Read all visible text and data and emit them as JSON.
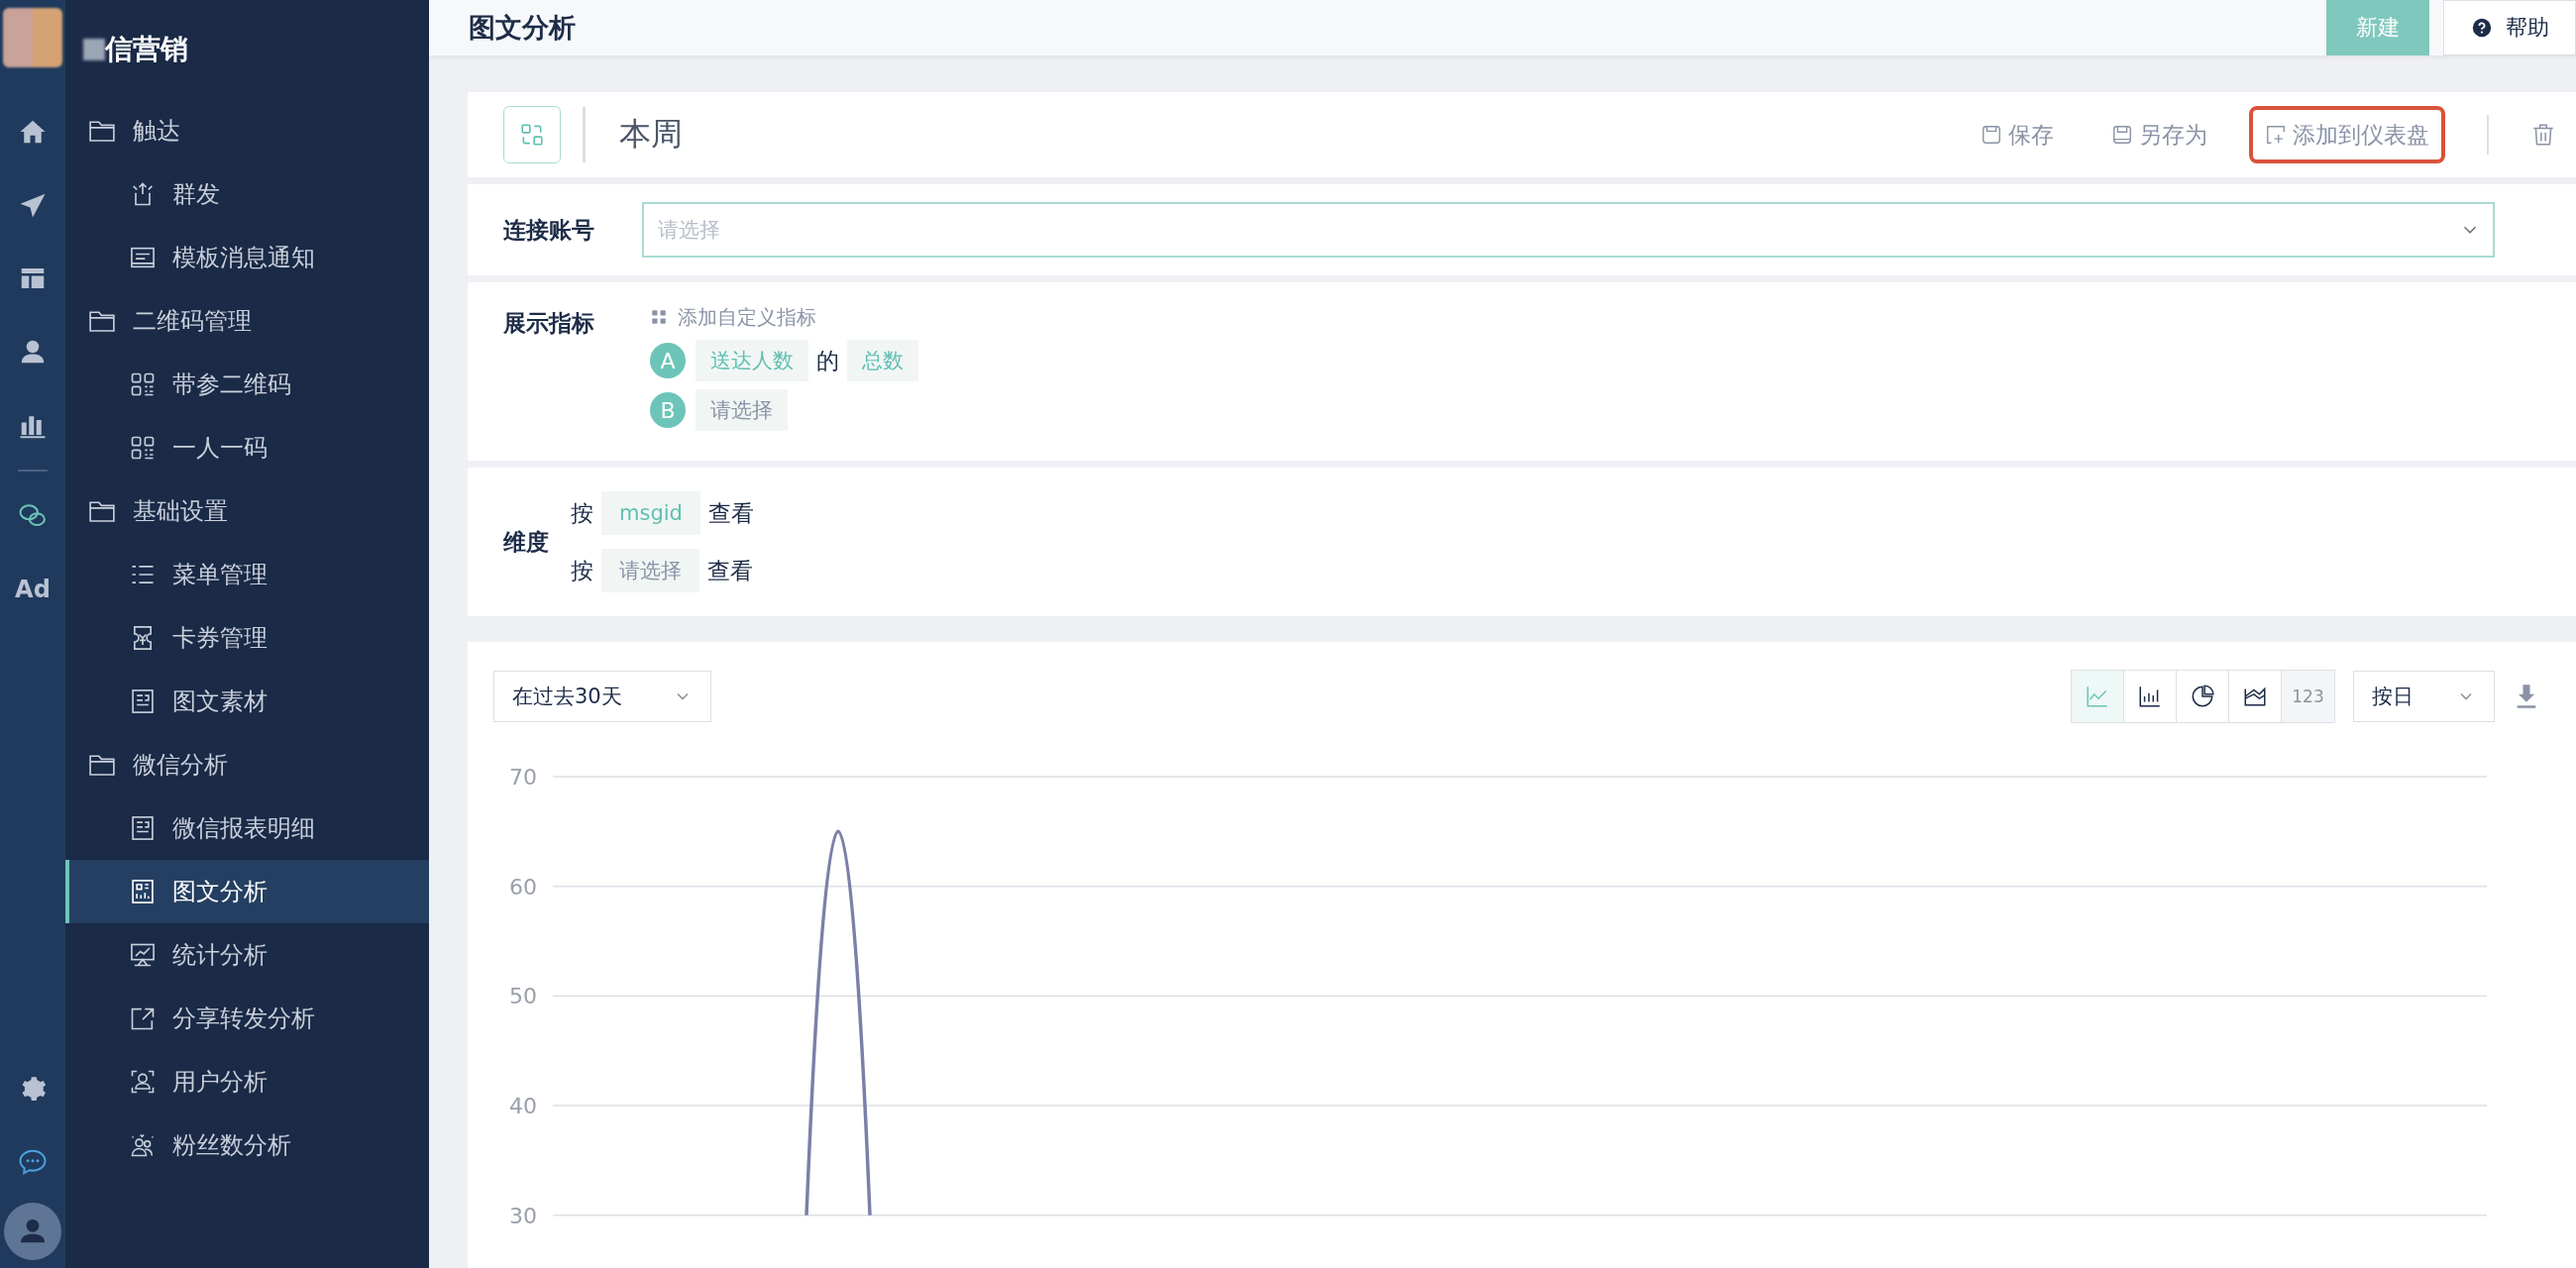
{
  "rail": {
    "top": [
      {
        "kind": "home"
      },
      {
        "kind": "send"
      },
      {
        "kind": "layout"
      },
      {
        "kind": "user"
      },
      {
        "kind": "chart"
      },
      {
        "kind": "divider"
      },
      {
        "kind": "wechat"
      },
      {
        "kind": "ad",
        "label": "Ad"
      }
    ],
    "bottom": [
      {
        "kind": "gear"
      },
      {
        "kind": "chat"
      },
      {
        "kind": "avatar"
      }
    ]
  },
  "sidebar": {
    "title": "信营销",
    "groups": [
      {
        "label": "触达",
        "children": [
          {
            "label": "群发",
            "selected": false
          },
          {
            "label": "模板消息通知",
            "selected": false
          }
        ]
      },
      {
        "label": "二维码管理",
        "children": [
          {
            "label": "带参二维码",
            "selected": false
          },
          {
            "label": "一人一码",
            "selected": false
          }
        ]
      },
      {
        "label": "基础设置",
        "children": [
          {
            "label": "菜单管理",
            "selected": false
          },
          {
            "label": "卡券管理",
            "selected": false
          },
          {
            "label": "图文素材",
            "selected": false
          }
        ]
      },
      {
        "label": "微信分析",
        "children": [
          {
            "label": "微信报表明细",
            "selected": false
          },
          {
            "label": "图文分析",
            "selected": true
          },
          {
            "label": "统计分析",
            "selected": false
          },
          {
            "label": "分享转发分析",
            "selected": false
          },
          {
            "label": "用户分析",
            "selected": false
          },
          {
            "label": "粉丝数分析",
            "selected": false
          }
        ]
      }
    ]
  },
  "header": {
    "title": "图文分析",
    "buttons": [
      {
        "kind": "primary",
        "label": "新建"
      },
      {
        "kind": "help",
        "label": "帮助"
      }
    ]
  },
  "report": {
    "name": "本周",
    "actions": [
      {
        "kind": "save",
        "label": "保存",
        "highlighted": false
      },
      {
        "kind": "save-as",
        "label": "另存为",
        "highlighted": false
      },
      {
        "kind": "dashboard",
        "label": "添加到仪表盘",
        "highlighted": true
      }
    ]
  },
  "account": {
    "label": "连接账号",
    "placeholder": "请选择"
  },
  "metrics": {
    "label": "展示指标",
    "add_link": "添加自定义指标",
    "items": [
      {
        "letter": "A",
        "field": {
          "text": "送达人数",
          "placeholder": false
        },
        "joiner": "的",
        "aggregate": "总数"
      },
      {
        "letter": "B",
        "field": {
          "text": "请选择",
          "placeholder": true
        }
      }
    ]
  },
  "dimensions": {
    "label": "维度",
    "rows": [
      {
        "prefix": "按",
        "value": "msgid",
        "placeholder": false,
        "suffix": "查看"
      },
      {
        "prefix": "按",
        "value": "请选择",
        "placeholder": true,
        "suffix": "查看"
      }
    ]
  },
  "chart_panel": {
    "range": "在过去30天",
    "chart_types": [
      {
        "kind": "line",
        "selected": true,
        "disabled": false
      },
      {
        "kind": "bar",
        "selected": false,
        "disabled": false
      },
      {
        "kind": "pie",
        "selected": false,
        "disabled": false
      },
      {
        "kind": "area",
        "selected": false,
        "disabled": false
      },
      {
        "kind": "number",
        "label": "123",
        "selected": false,
        "disabled": true
      }
    ],
    "granularity": "按日",
    "chart_data": {
      "type": "line",
      "grid": true,
      "ylim": [
        30,
        70
      ],
      "yticks": [
        30,
        40,
        50,
        60,
        70
      ],
      "series": [
        {
          "color": "#7b80a8",
          "values": [
            null,
            null,
            null,
            null,
            null,
            null,
            null,
            null,
            30,
            65,
            30,
            null,
            null,
            null,
            null,
            null,
            null,
            null,
            null,
            null,
            null,
            null,
            null,
            null,
            null,
            null,
            null,
            null,
            null,
            null,
            null,
            null,
            null,
            null,
            null,
            null,
            null,
            null,
            null,
            null,
            null,
            null,
            null,
            null,
            null,
            null,
            null,
            null,
            null,
            null,
            null,
            null,
            null,
            null,
            null,
            null,
            null,
            null,
            null,
            null,
            null,
            null
          ]
        }
      ]
    }
  }
}
